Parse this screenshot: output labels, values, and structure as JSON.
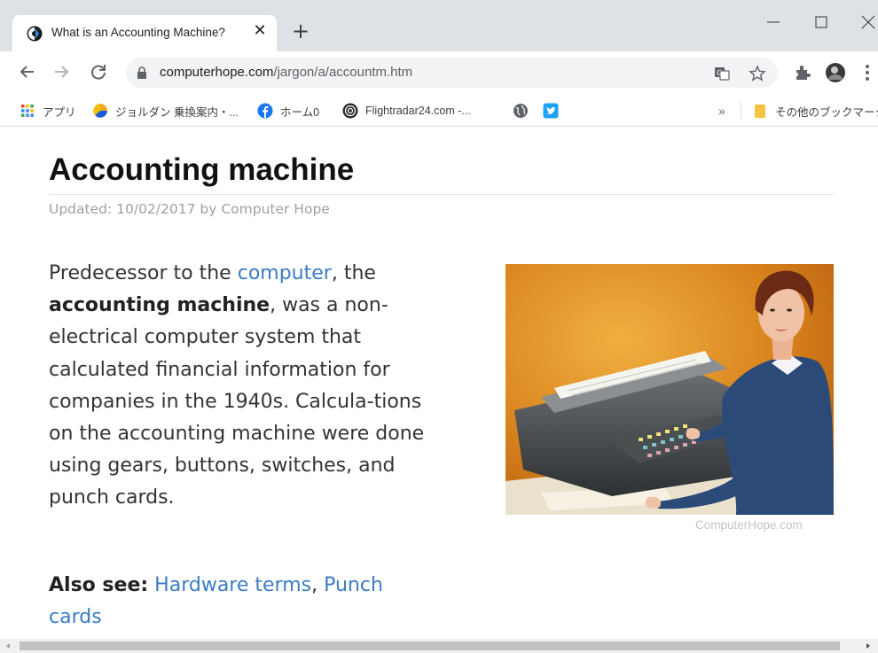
{
  "browser": {
    "tab": {
      "title": "What is an Accounting Machine?",
      "close_glyph": "✕",
      "favicon": "computerhope-favicon"
    },
    "new_tab_glyph": "+",
    "window_controls": {
      "minimize": "—",
      "maximize": "☐",
      "close": "✕"
    },
    "url": {
      "host": "computerhope.com",
      "path": "/jargon/a/accountm.htm"
    },
    "toolbar_icons": [
      "back-icon",
      "forward-icon",
      "reload-icon",
      "lock-icon",
      "translate-icon",
      "star-icon",
      "extensions-icon",
      "profile-avatar",
      "menu-icon"
    ],
    "bookmarks": [
      {
        "label": "アプリ",
        "icon": "apps-grid-icon"
      },
      {
        "label": "ジョルダン 乗換案内・...",
        "icon": "jorudan-icon"
      },
      {
        "label": "ホーム0",
        "icon": "facebook-icon"
      },
      {
        "label": "Flightradar24.com -...",
        "icon": "flightradar-icon"
      },
      {
        "label": "",
        "icon": "globe-icon"
      },
      {
        "label": "",
        "icon": "twitter-icon"
      }
    ],
    "bookmarks_overflow": "»",
    "other_bookmarks": "その他のブックマーク"
  },
  "page": {
    "title": "Accounting machine",
    "updated": "Updated: 10/02/2017 by Computer Hope",
    "para": {
      "t1": "Predecessor to the ",
      "link_computer": "computer",
      "t2": ", the ",
      "bold_term": "accounting machine",
      "t3": ", was a non-electrical computer system that calculated financial information for companies in the 1940s. Calcula-tions on the accounting machine were done using gears, buttons, switches, and punch cards."
    },
    "image_caption": "ComputerHope.com",
    "also_see": {
      "label": "Also see:",
      "link1": "Hardware terms",
      "sep": ", ",
      "link2": "Punch cards"
    }
  },
  "colors": {
    "link": "#3a7cc4",
    "tabstrip": "#dee1e6",
    "omnibox": "#f1f3f4"
  }
}
